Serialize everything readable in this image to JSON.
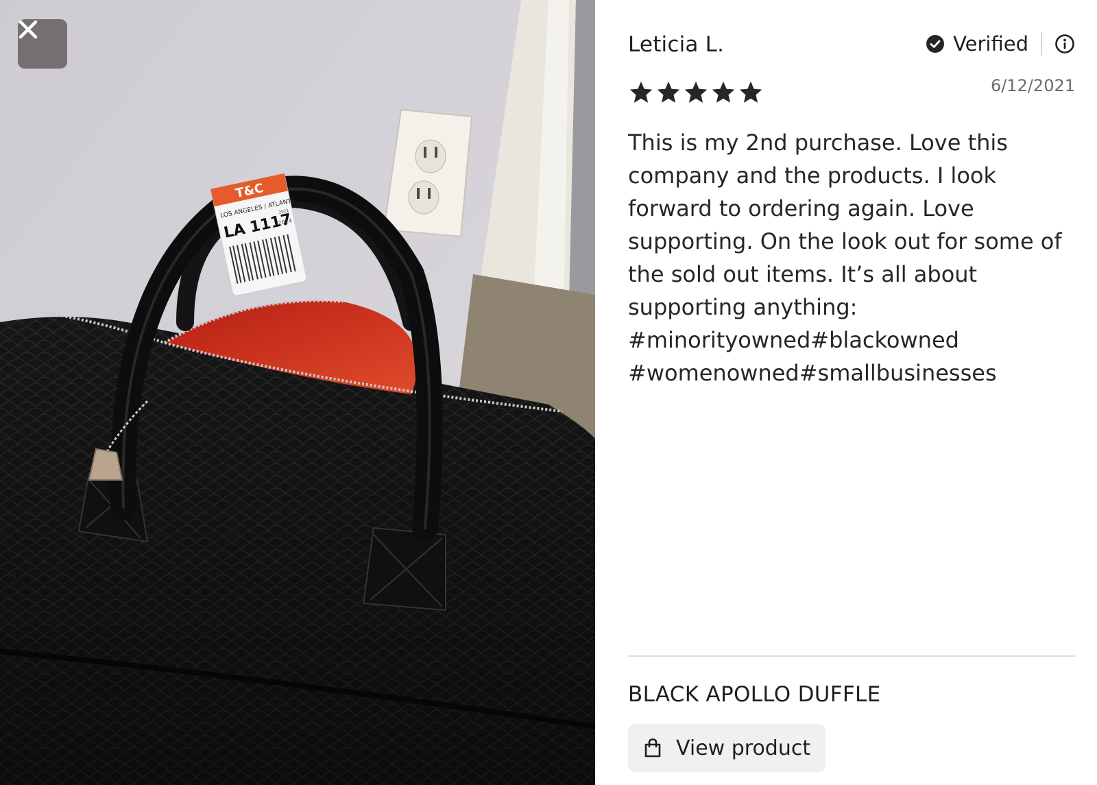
{
  "review": {
    "reviewer_name": "Leticia L.",
    "verified_label": "Verified",
    "date": "6/12/2021",
    "rating": 5,
    "rating_max": 5,
    "text": "This is my 2nd purchase. Love this company and the products. I look forward to ordering again. Love supporting. On the look out for some of the sold out items. It’s all about supporting anything: #minorityowned#blackowned #womenowned#smallbusinesses"
  },
  "product": {
    "name": "BLACK APOLLO DUFFLE",
    "view_label": "View product"
  },
  "photo": {
    "tag_brand": "T&C",
    "tag_route": "LOS ANGELES / ATLANTA",
    "tag_code": "LA 1117",
    "tag_year_1": "2021",
    "tag_year_2": "2014"
  },
  "icons": {
    "close": "close-icon",
    "verified": "check-circle-icon",
    "info": "info-icon",
    "star": "star-icon",
    "bag": "shopping-bag-icon"
  },
  "colors": {
    "star": "#262626",
    "text": "#262626",
    "date": "#6b6b6b",
    "button_bg": "#f0f0f0",
    "close_bg": "#5a5656"
  }
}
